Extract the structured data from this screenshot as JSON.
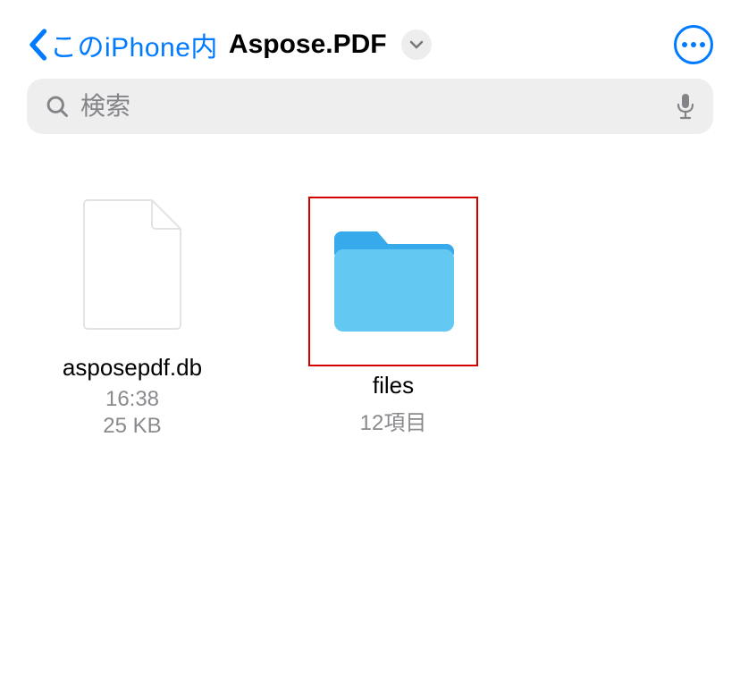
{
  "header": {
    "back_label": "このiPhone内",
    "title": "Aspose.PDF"
  },
  "search": {
    "placeholder": "検索"
  },
  "items": [
    {
      "type": "file",
      "name": "asposepdf.db",
      "meta1": "16:38",
      "meta2": "25 KB",
      "highlighted": false
    },
    {
      "type": "folder",
      "name": "files",
      "meta1": "12項目",
      "highlighted": true
    }
  ],
  "colors": {
    "accent": "#007aff",
    "folder_light": "#63c9f3",
    "folder_dark": "#37aaeb",
    "highlight": "#d40000"
  }
}
